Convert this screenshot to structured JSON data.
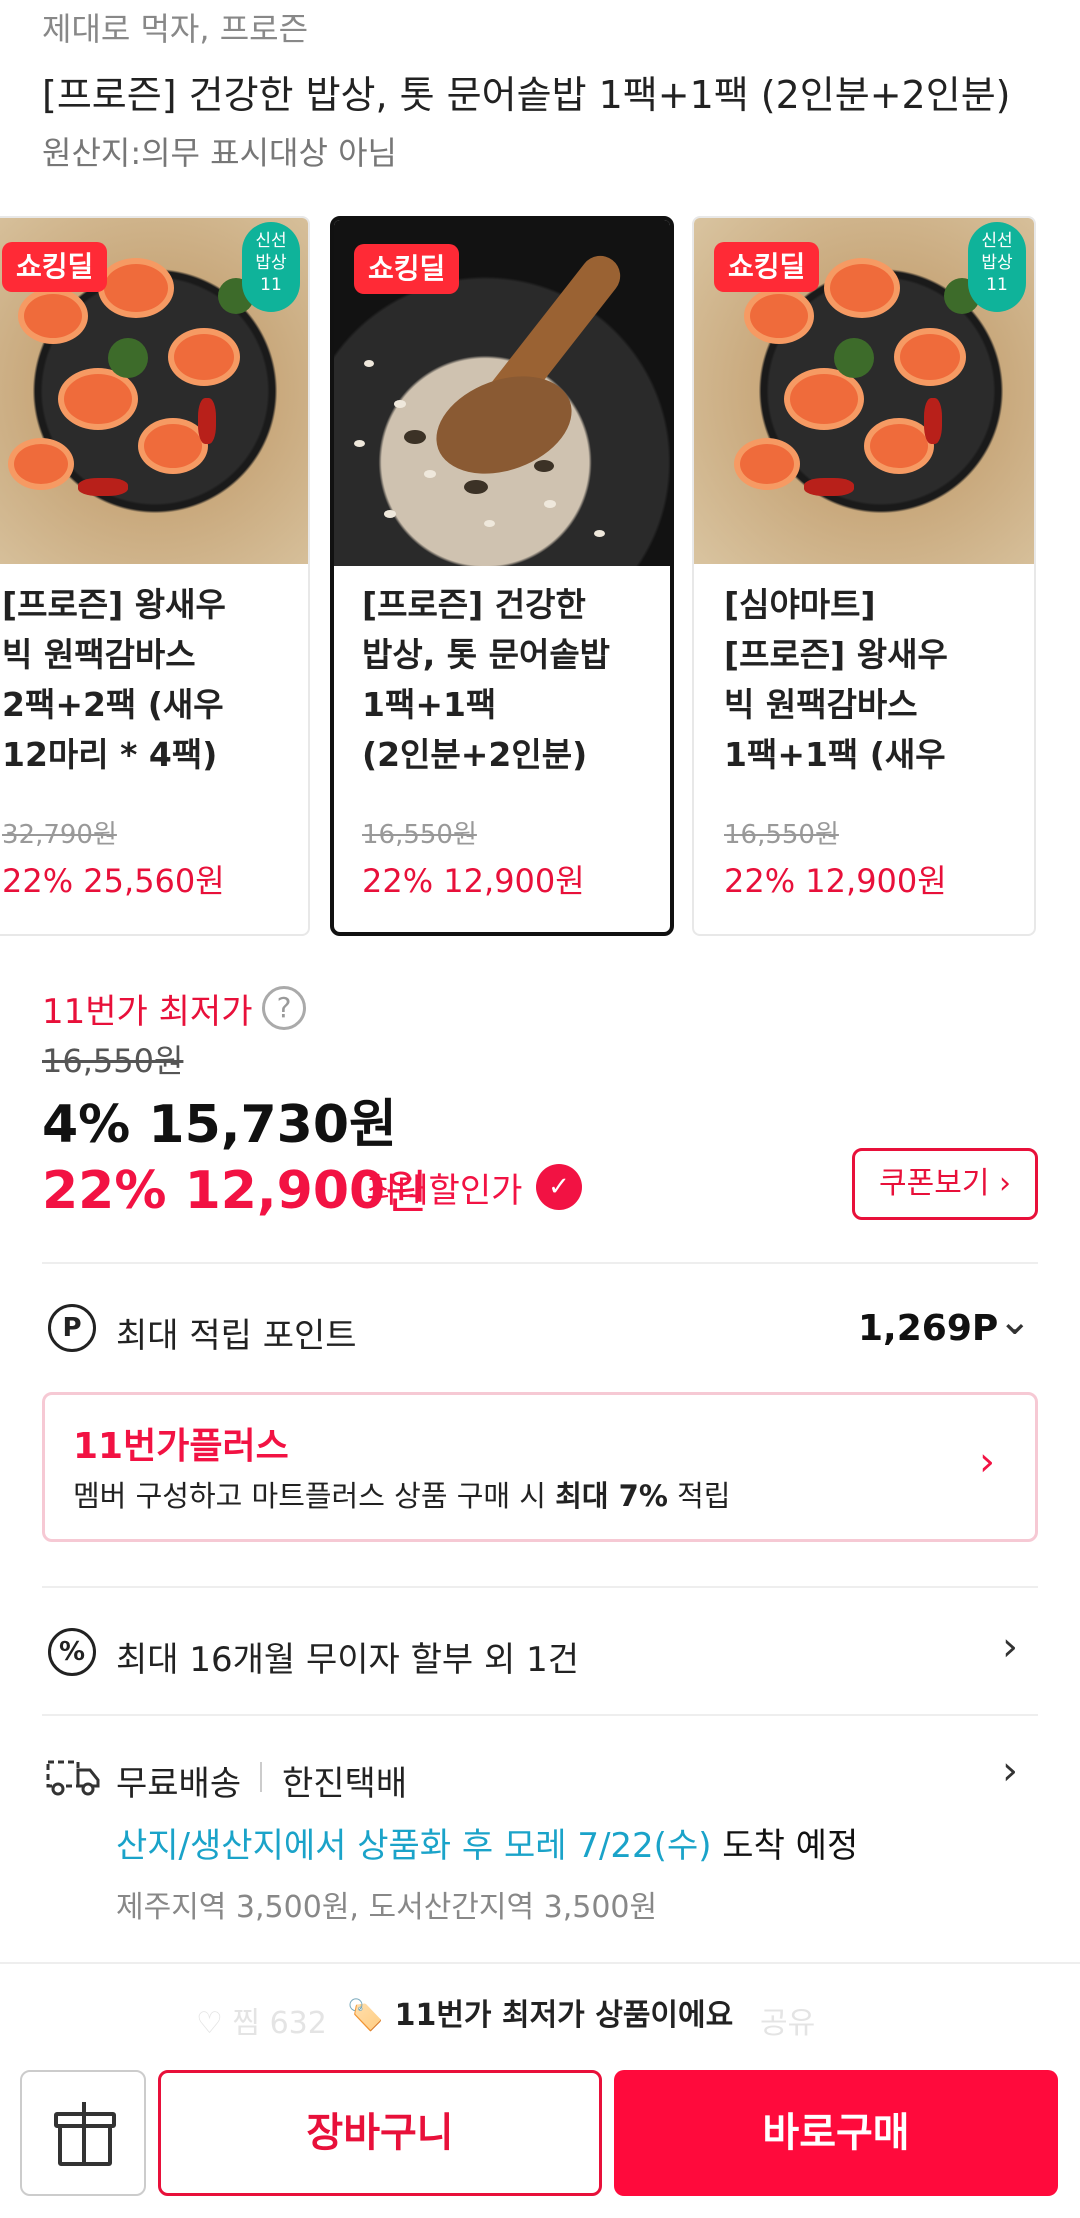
{
  "header": {
    "brand": "제대로 먹자, 프로즌",
    "title": "[프로즌] 건강한 밥상, 톳 문어솥밥 1팩+1팩 (2인분+2인분)",
    "origin": "원산지:의무 표시대상 아님"
  },
  "carousel": [
    {
      "badge": "쇼킹딜",
      "fresh_badge": [
        "신선",
        "밥상",
        "11"
      ],
      "name_lines": [
        "[프로즌] 왕새우",
        "빅 원팩감바스",
        "2팩+2팩 (새우",
        "12마리 * 4팩)"
      ],
      "original_price": "32,790원",
      "sale_price": "22% 25,560원",
      "selected": false
    },
    {
      "badge": "쇼킹딜",
      "name_lines": [
        "[프로즌] 건강한",
        "밥상, 톳 문어솥밥",
        "1팩+1팩",
        "(2인분+2인분)"
      ],
      "original_price": "16,550원",
      "sale_price": "22% 12,900원",
      "selected": true
    },
    {
      "badge": "쇼킹딜",
      "fresh_badge": [
        "신선",
        "밥상",
        "11"
      ],
      "name_lines": [
        "[심야마트]",
        "[프로즌] 왕새우",
        "빅 원팩감바스",
        "1팩+1팩 (새우"
      ],
      "original_price": "16,550원",
      "sale_price": "22% 12,900원",
      "selected": false
    }
  ],
  "pricing": {
    "lowest_label": "11번가 최저가",
    "help_icon": "?",
    "original_price": "16,550원",
    "base_price": "4% 15,730원",
    "sale_percent_price": "22% 12,900",
    "sale_won": "원",
    "max_discount_label": "최대할인가",
    "coupon_button": "쿠폰보기 ›"
  },
  "points": {
    "icon": "P",
    "label": "최대 적립 포인트",
    "value": "1,269P",
    "chevron": "⌄"
  },
  "plus": {
    "title": "11번가플러스",
    "desc_prefix": "멤버 구성하고 마트플러스 상품 구매 시 ",
    "desc_bold": "최대 7%",
    "desc_suffix": " 적립",
    "chevron": "›"
  },
  "installment": {
    "icon": "%",
    "label": "최대 16개월 무이자 할부 외 1건",
    "chevron": "›"
  },
  "shipping": {
    "free_label": "무료배송",
    "carrier": "한진택배",
    "eta_highlight": "산지/생산지에서 상품화 후 모레 7/22(수)",
    "eta_suffix": " 도착 예정",
    "extra_fee": "제주지역 3,500원, 도서산간지역 3,500원",
    "chevron": "›"
  },
  "notice": {
    "icon": "🏷️",
    "text": "11번가 최저가 상품이에요",
    "ghost_like": "♡ 찜 632",
    "ghost_share": "공유"
  },
  "bottom_bar": {
    "cart_label": "장바구니",
    "buy_label": "바로구매"
  },
  "colors": {
    "accent": "#f21243",
    "teal": "#1aa3c9",
    "badge_red": "#ff2a36",
    "fresh_green": "#0fb39a"
  }
}
